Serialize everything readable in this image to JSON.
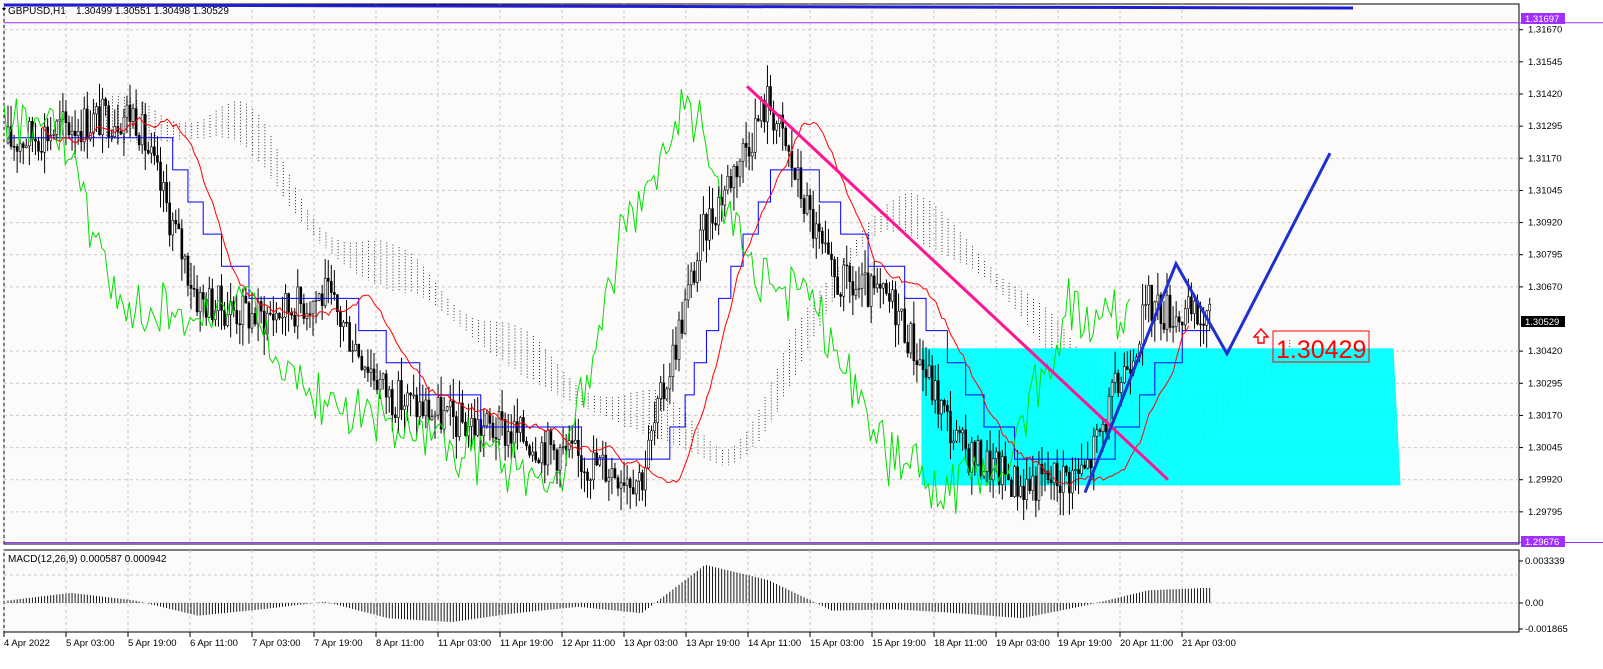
{
  "window": {
    "symbol_title": "GBPUSD,H1",
    "ohlc": "1.30499 1.30551 1.30498 1.30529",
    "macd_title": "MACD(12,26,9) 0.000587 0.000942"
  },
  "colors": {
    "background": "#fdfafa",
    "grid": "#c8c8c8",
    "candle": "#000000",
    "tenkan": "#ff0000",
    "kijun": "#0000ff",
    "chikou": "#00e000",
    "cloud": "#000000",
    "zone": "#00ffff",
    "trendline": "#ff1493",
    "projection": "#1f2fd0",
    "hline": "#a030ff"
  },
  "price_axis": {
    "min": 1.2967,
    "max": 1.3177,
    "ticks": [
      "1.31670",
      "1.31545",
      "1.31420",
      "1.31295",
      "1.31170",
      "1.31045",
      "1.30920",
      "1.30795",
      "1.30670",
      "1.30420",
      "1.30295",
      "1.30170",
      "1.30045",
      "1.29920",
      "1.29795"
    ],
    "current_price": "1.30529",
    "upper_line_price": "1.31697",
    "lower_line_price": "1.29676"
  },
  "macd_axis": {
    "ticks": [
      "0.003339",
      "0.00",
      "-0.001865"
    ]
  },
  "time_axis": {
    "labels": [
      "4 Apr 2022",
      "5 Apr 03:00",
      "5 Apr 19:00",
      "6 Apr 11:00",
      "7 Apr 03:00",
      "7 Apr 19:00",
      "8 Apr 11:00",
      "11 Apr 03:00",
      "11 Apr 19:00",
      "12 Apr 11:00",
      "13 Apr 03:00",
      "13 Apr 19:00",
      "14 Apr 11:00",
      "15 Apr 03:00",
      "15 Apr 19:00",
      "18 Apr 11:00",
      "19 Apr 03:00",
      "19 Apr 19:00",
      "20 Apr 11:00",
      "21 Apr 03:00"
    ]
  },
  "annotations": {
    "level_label": "1.30429",
    "level_price": 1.30429
  },
  "chart_data": {
    "type": "candlestick",
    "symbol": "GBPUSD",
    "timeframe": "H1",
    "ohlc_last": {
      "open": 1.30499,
      "high": 1.30551,
      "low": 1.30498,
      "close": 1.30529
    },
    "ylim": [
      1.2967,
      1.3177
    ],
    "x": [
      "4 Apr 2022",
      "5 Apr 03:00",
      "5 Apr 19:00",
      "6 Apr 11:00",
      "7 Apr 03:00",
      "7 Apr 19:00",
      "8 Apr 11:00",
      "11 Apr 03:00",
      "11 Apr 19:00",
      "12 Apr 11:00",
      "13 Apr 03:00",
      "13 Apr 19:00",
      "14 Apr 11:00",
      "15 Apr 03:00",
      "15 Apr 19:00",
      "18 Apr 11:00",
      "19 Apr 03:00",
      "19 Apr 19:00",
      "20 Apr 11:00",
      "21 Apr 03:00"
    ],
    "series": [
      {
        "values": [
          1.3123,
          1.313,
          1.3135,
          1.3062,
          1.3055,
          1.3064,
          1.3025,
          1.3015,
          1.301,
          1.3,
          1.2993,
          1.309,
          1.314,
          1.307,
          1.306,
          1.3005,
          1.299,
          1.2995,
          1.306,
          1.3053
        ]
      }
    ],
    "macd": {
      "params": "12,26,9",
      "main": 0.000587,
      "signal": 0.000942,
      "values": [
        0.0002,
        0.0008,
        0.0002,
        -0.001,
        -0.0005,
        0.0001,
        -0.0012,
        -0.0015,
        -0.0008,
        -0.0003,
        -0.0008,
        0.003,
        0.0018,
        -0.0006,
        -0.0005,
        -0.0008,
        -0.0012,
        -0.0002,
        0.001,
        0.0012
      ]
    },
    "annotations": {
      "trendline": {
        "from": {
          "x": "14 Apr 11:00",
          "y": 1.3145
        },
        "to": {
          "x": "19 Apr 19:00",
          "y": 1.2992
        }
      },
      "zone": {
        "price_top": 1.30429,
        "price_bottom": 1.299,
        "from_x": "15 Apr 19:00"
      },
      "projection_path": [
        1.2987,
        1.3076,
        1.3041,
        1.3119
      ]
    }
  }
}
